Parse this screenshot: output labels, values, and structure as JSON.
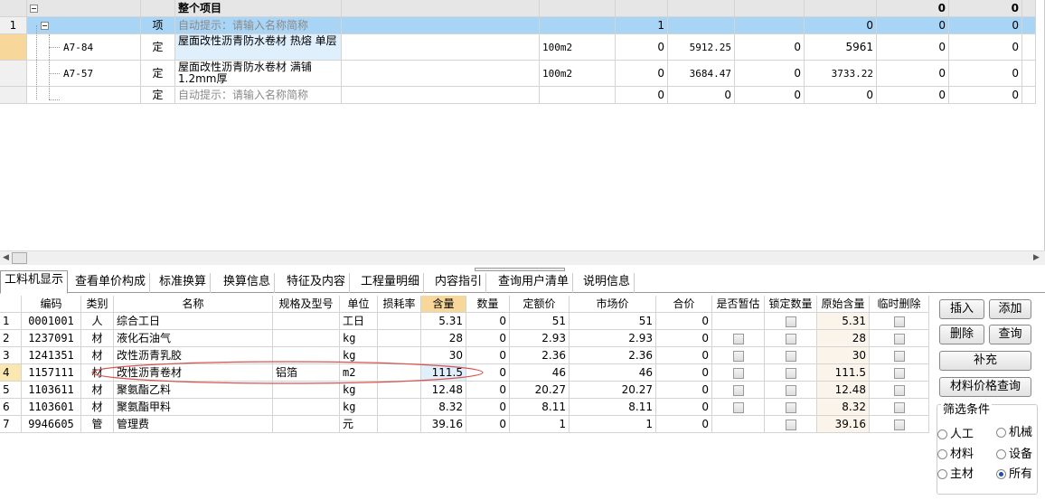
{
  "top_grid": {
    "header_row": {
      "title": "整个项目",
      "c13": "0",
      "c14": "0"
    },
    "rows": [
      {
        "num": "1",
        "code": "",
        "type": "项",
        "name": "自动提示：请输入名称简称",
        "spec": "",
        "unit": "",
        "qty": "1",
        "c8": "",
        "c9": "",
        "c10": "0",
        "c11": "0",
        "c12": "0",
        "hint": true
      },
      {
        "num": "",
        "code": "A7-84",
        "type": "定",
        "name": "屋面改性沥青防水卷材 热熔 单层",
        "spec": "",
        "unit": "100m2",
        "qty": "0",
        "c8": "5912.25",
        "c9": "0",
        "c10": "5961",
        "c11": "0",
        "c12": "0",
        "hint": false
      },
      {
        "num": "",
        "code": "A7-57",
        "type": "定",
        "name": "屋面改性沥青防水卷材 满铺 1.2mm厚",
        "spec": "",
        "unit": "100m2",
        "qty": "0",
        "c8": "3684.47",
        "c9": "0",
        "c10": "3733.22",
        "c11": "0",
        "c12": "0",
        "hint": false
      },
      {
        "num": "",
        "code": "",
        "type": "定",
        "name": "自动提示：请输入名称简称",
        "spec": "",
        "unit": "",
        "qty": "0",
        "c8": "0",
        "c9": "0",
        "c10": "0",
        "c11": "0",
        "c12": "0",
        "hint": true
      }
    ]
  },
  "tabs": [
    {
      "label": "工料机显示",
      "active": true
    },
    {
      "label": "查看单价构成"
    },
    {
      "label": "标准换算"
    },
    {
      "label": "换算信息"
    },
    {
      "label": "特征及内容"
    },
    {
      "label": "工程量明细"
    },
    {
      "label": "内容指引"
    },
    {
      "label": "查询用户清单"
    },
    {
      "label": "说明信息"
    }
  ],
  "bottom_grid": {
    "headers": [
      "编码",
      "类别",
      "名称",
      "规格及型号",
      "单位",
      "损耗率",
      "含量",
      "数量",
      "定额价",
      "市场价",
      "合价",
      "是否暂估",
      "锁定数量",
      "原始含量",
      "临时删除"
    ],
    "rows": [
      {
        "num": "1",
        "code": "0001001",
        "cat": "人",
        "name": "综合工日",
        "spec": "",
        "unit": "工日",
        "loss": "",
        "content": "5.31",
        "qty": "0",
        "price": "51",
        "market": "51",
        "total": "0",
        "est": false,
        "lock": true,
        "orig": "5.31",
        "del": true
      },
      {
        "num": "2",
        "code": "1237091",
        "cat": "材",
        "name": "液化石油气",
        "spec": "",
        "unit": "kg",
        "loss": "",
        "content": "28",
        "qty": "0",
        "price": "2.93",
        "market": "2.93",
        "total": "0",
        "est": true,
        "lock": true,
        "orig": "28",
        "del": true
      },
      {
        "num": "3",
        "code": "1241351",
        "cat": "材",
        "name": "改性沥青乳胶",
        "spec": "",
        "unit": "kg",
        "loss": "",
        "content": "30",
        "qty": "0",
        "price": "2.36",
        "market": "2.36",
        "total": "0",
        "est": true,
        "lock": true,
        "orig": "30",
        "del": true
      },
      {
        "num": "4",
        "code": "1157111",
        "cat": "材",
        "name": "改性沥青卷材",
        "spec": "铝箔",
        "unit": "m2",
        "loss": "",
        "content": "111.5",
        "qty": "0",
        "price": "46",
        "market": "46",
        "total": "0",
        "est": true,
        "lock": true,
        "orig": "111.5",
        "del": true
      },
      {
        "num": "5",
        "code": "1103611",
        "cat": "材",
        "name": "聚氨酯乙料",
        "spec": "",
        "unit": "kg",
        "loss": "",
        "content": "12.48",
        "qty": "0",
        "price": "20.27",
        "market": "20.27",
        "total": "0",
        "est": true,
        "lock": true,
        "orig": "12.48",
        "del": true
      },
      {
        "num": "6",
        "code": "1103601",
        "cat": "材",
        "name": "聚氨酯甲料",
        "spec": "",
        "unit": "kg",
        "loss": "",
        "content": "8.32",
        "qty": "0",
        "price": "8.11",
        "market": "8.11",
        "total": "0",
        "est": true,
        "lock": true,
        "orig": "8.32",
        "del": true
      },
      {
        "num": "7",
        "code": "9946605",
        "cat": "管",
        "name": "管理费",
        "spec": "",
        "unit": "元",
        "loss": "",
        "content": "39.16",
        "qty": "0",
        "price": "1",
        "market": "1",
        "total": "0",
        "est": false,
        "lock": true,
        "orig": "39.16",
        "del": true
      }
    ]
  },
  "right_panel": {
    "insert": "插入",
    "add": "添加",
    "delete": "删除",
    "query": "查询",
    "supplement": "补充",
    "material_price_query": "材料价格查询",
    "filter_title": "筛选条件",
    "filters": [
      {
        "label": "人工",
        "checked": false
      },
      {
        "label": "机械",
        "checked": false
      },
      {
        "label": "材料",
        "checked": false
      },
      {
        "label": "设备",
        "checked": false
      },
      {
        "label": "主材",
        "checked": false
      },
      {
        "label": "所有",
        "checked": true
      }
    ]
  },
  "colors": {
    "selected_row": "#a8d4f5",
    "header_highlight": "#f7d79a",
    "annotation_ellipse": "#d9534f"
  }
}
